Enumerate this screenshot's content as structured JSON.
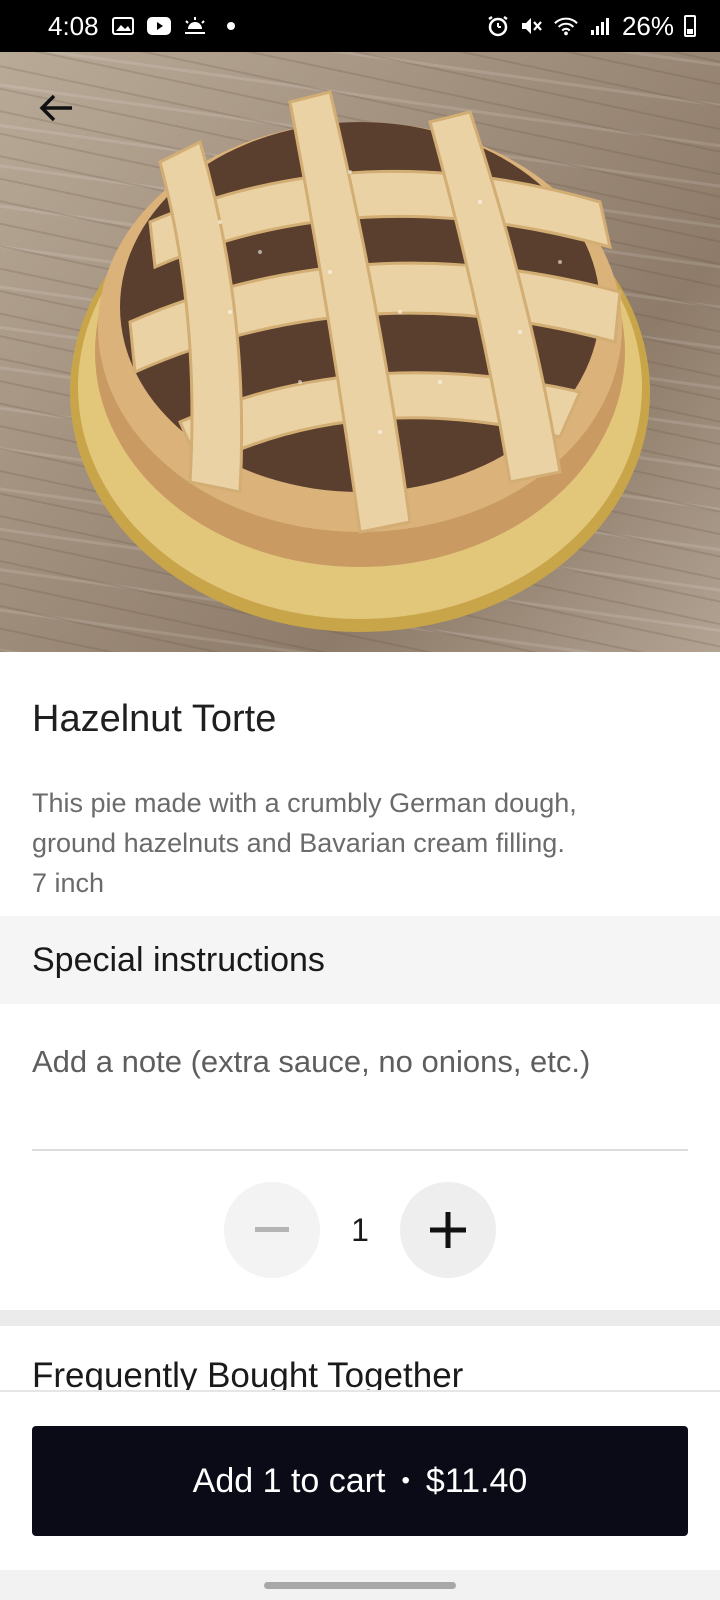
{
  "status_bar": {
    "time": "4:08",
    "battery": "26%",
    "left_icons": [
      "image-icon",
      "youtube-icon",
      "weather-icon",
      "dot-icon"
    ],
    "right_icons": [
      "alarm-icon",
      "mute-icon",
      "wifi-icon",
      "signal-icon",
      "battery-icon"
    ]
  },
  "product": {
    "title": "Hazelnut Torte",
    "description_lines": [
      "This pie made with a crumbly German dough,",
      "ground hazelnuts and Bavarian cream filling.",
      "7 inch"
    ]
  },
  "special_instructions": {
    "heading": "Special instructions",
    "note_placeholder": "Add a note (extra sauce, no onions, etc.)"
  },
  "quantity": {
    "value": "1"
  },
  "sections": {
    "frequently_bought_together": "Frequently Bought Together"
  },
  "cart": {
    "label": "Add 1 to cart",
    "separator": "•",
    "price": "$11.40"
  },
  "colors": {
    "cart_button_bg": "#0b0b18",
    "section_bg": "#f5f5f5"
  }
}
